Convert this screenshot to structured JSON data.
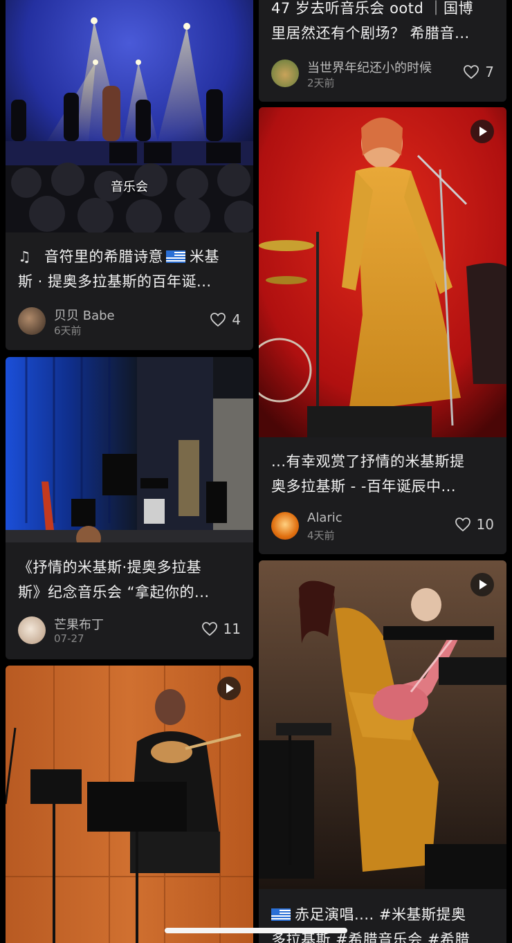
{
  "feed": {
    "left": [
      {
        "image_label": "音乐会",
        "title_lines": [
          "音符里的希腊诗意",
          "斯 · 提奥多拉基斯的百年诞..."
        ],
        "title_after_flag": "米基",
        "title_icon": "music-note-icon",
        "author": "贝贝 Babe",
        "time": "6天前",
        "likes": "4"
      },
      {
        "title_lines": [
          "《抒情的米基斯·提奥多拉基",
          "斯》纪念音乐会 “拿起你的..."
        ],
        "author": "芒果布丁",
        "time": "07-27",
        "likes": "11"
      },
      {
        "has_video": true
      }
    ],
    "right": [
      {
        "title_lines": [
          "47 岁去听音乐会 ootd ｜国博",
          "里居然还有个剧场？ 希腊音..."
        ],
        "author": "当世界年纪还小的时候",
        "time": "2天前",
        "likes": "7"
      },
      {
        "has_video": true,
        "title_lines": [
          "...有幸观赏了抒情的米基斯提",
          "奥多拉基斯 - -百年诞辰中..."
        ],
        "author": "Alaric",
        "time": "4天前",
        "likes": "10"
      },
      {
        "has_video": true,
        "title_lines": [
          "赤足演唱.... #米基斯提奥",
          "多拉基斯 #希腊音乐会 #希腊"
        ]
      }
    ]
  },
  "colors": {
    "background": "#000000",
    "card": "#1c1c1e",
    "text": "#f2f2f2",
    "muted": "#8a8a8a"
  }
}
